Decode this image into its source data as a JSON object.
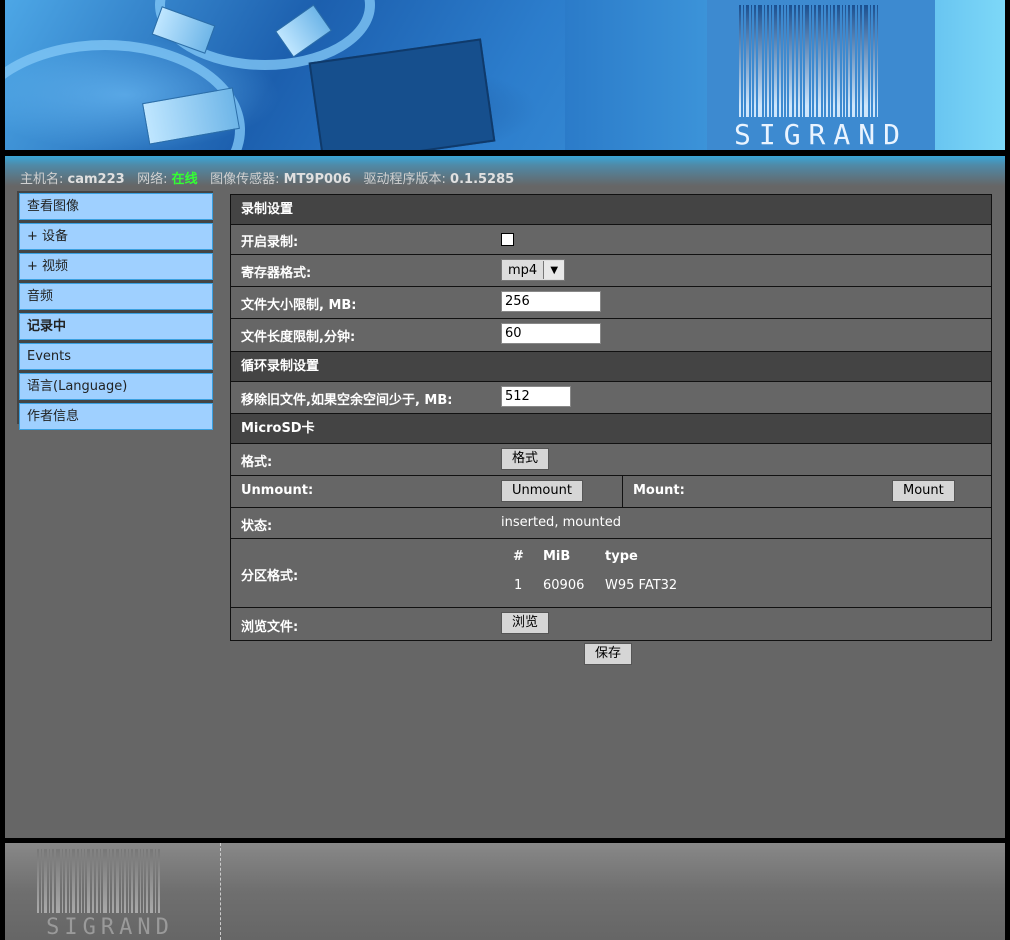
{
  "header": {
    "brand": "SIGRAND",
    "chip_text": "IP175C\n051512\nFUH6763"
  },
  "status": {
    "hostname_label": "主机名:",
    "hostname": "cam223",
    "network_label": "网络:",
    "network": "在线",
    "sensor_label": "图像传感器:",
    "sensor": "MT9P006",
    "driver_label": "驱动程序版本:",
    "driver": "0.1.5285"
  },
  "sidebar": {
    "items": [
      {
        "label": "查看图像"
      },
      {
        "label": "+ 设备"
      },
      {
        "label": "+ 视频"
      },
      {
        "label": "音频"
      },
      {
        "label": "记录中"
      },
      {
        "label": "Events"
      },
      {
        "label": "语言(Language)"
      },
      {
        "label": "作者信息"
      }
    ]
  },
  "form": {
    "section_record": "录制设置",
    "enable_label": "开启录制:",
    "container_label": "寄存器格式:",
    "container_value": "mp4",
    "filesize_label": "文件大小限制, MB:",
    "filesize_value": "256",
    "duration_label": "文件长度限制,分钟:",
    "duration_value": "60",
    "section_loop": "循环录制设置",
    "remove_label": "移除旧文件,如果空余空间少于, MB:",
    "remove_value": "512",
    "section_sd": "MicroSD卡",
    "format_label": "格式:",
    "format_button": "格式",
    "unmount_label": "Unmount:",
    "unmount_button": "Unmount",
    "mount_label": "Mount:",
    "mount_button": "Mount",
    "state_label": "状态:",
    "state_value": "inserted, mounted",
    "partition_label": "分区格式:",
    "partition_headers": [
      "#",
      "MiB",
      "type"
    ],
    "partition_rows": [
      [
        "1",
        "60906",
        "W95 FAT32"
      ]
    ],
    "browse_label": "浏览文件:",
    "browse_button": "浏览",
    "save_button": "保存"
  },
  "colors": {
    "online": "#33ff33",
    "nav_bg": "#9fd0ff",
    "panel": "#666666"
  }
}
